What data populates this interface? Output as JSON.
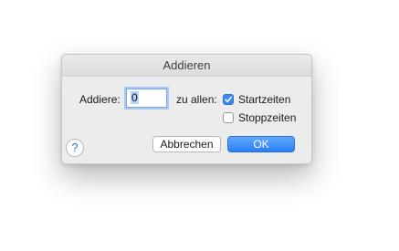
{
  "dialog": {
    "title": "Addieren",
    "add_label": "Addiere:",
    "add_value": "0",
    "to_all_label": "zu allen:",
    "start_times": {
      "label": "Startzeiten",
      "checked": true
    },
    "stop_times": {
      "label": "Stoppzeiten",
      "checked": false
    },
    "help_label": "?",
    "cancel_label": "Abbrechen",
    "ok_label": "OK"
  },
  "colors": {
    "accent": "#3a8af5",
    "dialog_bg": "#ececec"
  }
}
